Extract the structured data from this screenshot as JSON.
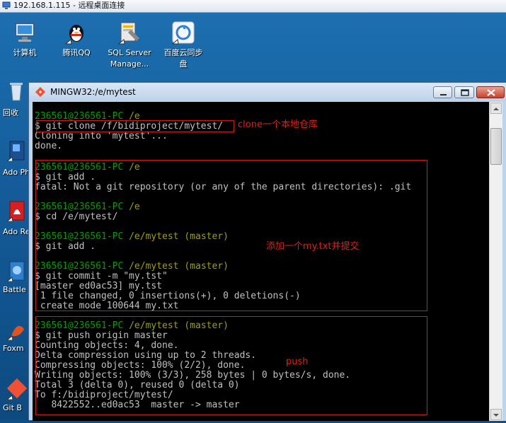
{
  "rdp": {
    "title": "192.168.1.115 - 远程桌面连接"
  },
  "desktop": {
    "icons": [
      {
        "label": "计算机"
      },
      {
        "label": "腾讯QQ"
      },
      {
        "label": "SQL Server\nManage..."
      },
      {
        "label": "百度云同步\n盘"
      }
    ],
    "side_icons": [
      {
        "label": "回收"
      },
      {
        "label": "Ado\nPhoto"
      },
      {
        "label": "Ado\nReade"
      },
      {
        "label": "Battle"
      },
      {
        "label": "Foxm"
      },
      {
        "label": "Git B"
      }
    ]
  },
  "window": {
    "title": "MINGW32:/e/mytest"
  },
  "terminal": {
    "lines": [
      {
        "prompt": "236561@236561-PC",
        "path": "/e",
        "branch": ""
      },
      {
        "text": "$ git clone /f/bidiproject/mytest/"
      },
      {
        "text": "Cloning into 'mytest'..."
      },
      {
        "text": "done."
      },
      {
        "prompt": "236561@236561-PC",
        "path": "/e",
        "branch": ""
      },
      {
        "text": "$ git add ."
      },
      {
        "text": "fatal: Not a git repository (or any of the parent directories): .git"
      },
      {
        "prompt": "236561@236561-PC",
        "path": "/e",
        "branch": ""
      },
      {
        "text": "$ cd /e/mytest/"
      },
      {
        "prompt": "236561@236561-PC",
        "path": "/e/mytest",
        "branch": "(master)"
      },
      {
        "text": "$ git add ."
      },
      {
        "prompt": "236561@236561-PC",
        "path": "/e/mytest",
        "branch": "(master)"
      },
      {
        "text": "$ git commit -m \"my.tst\""
      },
      {
        "text": "[master ed0ac53] my.tst"
      },
      {
        "text": " 1 file changed, 0 insertions(+), 0 deletions(-)"
      },
      {
        "text": " create mode 100644 my.txt"
      },
      {
        "prompt": "236561@236561-PC",
        "path": "/e/mytest",
        "branch": "(master)"
      },
      {
        "text": "$ git push origin master"
      },
      {
        "text": "Counting objects: 4, done."
      },
      {
        "text": "Delta compression using up to 2 threads."
      },
      {
        "text": "Compressing objects: 100% (2/2), done."
      },
      {
        "text": "Writing objects: 100% (3/3), 258 bytes | 0 bytes/s, done."
      },
      {
        "text": "Total 3 (delta 0), reused 0 (delta 0)"
      },
      {
        "text": "To f:/bidiproject/mytest/"
      },
      {
        "text": "   8422552..ed0ac53  master -> master"
      }
    ]
  },
  "annotations": {
    "clone": "clone一个本地仓库",
    "add_commit": "添加一个my.txt并提交",
    "push": "push"
  }
}
